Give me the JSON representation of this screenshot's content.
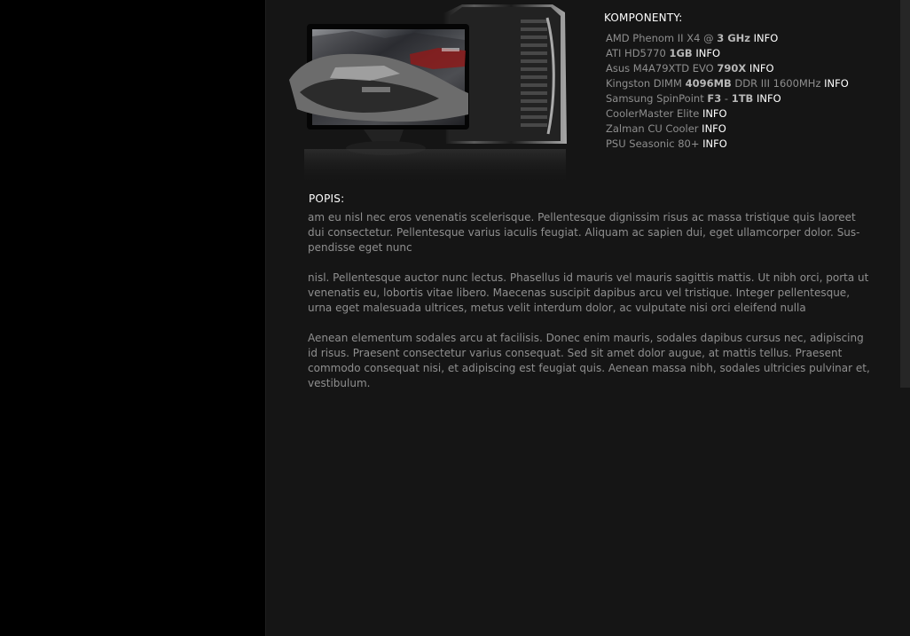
{
  "colors": {
    "page_background": "#000000",
    "content_background": "#151515",
    "heading_text": "#ffffff",
    "body_text": "#8f8f8f",
    "emphasis_text": "#b7b7b7",
    "link_text": "#ffffff"
  },
  "hero": {
    "icon_name": "computer-setup-image"
  },
  "components": {
    "heading": "KOMPONENTY:",
    "items": [
      {
        "segments": [
          {
            "text": "AMD Phenom II X4 @ ",
            "style": "normal"
          },
          {
            "text": "3 GHz",
            "style": "bold"
          },
          {
            "text": " ",
            "style": "normal"
          }
        ],
        "info_label": "INFO"
      },
      {
        "segments": [
          {
            "text": "ATI HD5770 ",
            "style": "normal"
          },
          {
            "text": "1GB",
            "style": "bold"
          },
          {
            "text": " ",
            "style": "normal"
          }
        ],
        "info_label": "INFO"
      },
      {
        "segments": [
          {
            "text": "Asus M4A79XTD EVO ",
            "style": "normal"
          },
          {
            "text": "790X",
            "style": "bold"
          },
          {
            "text": " ",
            "style": "normal"
          }
        ],
        "info_label": "INFO"
      },
      {
        "segments": [
          {
            "text": "Kingston DIMM ",
            "style": "normal"
          },
          {
            "text": "4096MB",
            "style": "bold"
          },
          {
            "text": " DDR III 1600MHz ",
            "style": "normal"
          }
        ],
        "info_label": "INFO"
      },
      {
        "segments": [
          {
            "text": "Samsung SpinPoint ",
            "style": "normal"
          },
          {
            "text": "F3",
            "style": "bold"
          },
          {
            "text": " - ",
            "style": "normal"
          },
          {
            "text": "1TB",
            "style": "bold"
          },
          {
            "text": " ",
            "style": "normal"
          }
        ],
        "info_label": "INFO"
      },
      {
        "segments": [
          {
            "text": "CoolerMaster Elite ",
            "style": "normal"
          }
        ],
        "info_label": "INFO"
      },
      {
        "segments": [
          {
            "text": "Zalman CU Cooler ",
            "style": "normal"
          }
        ],
        "info_label": "INFO"
      },
      {
        "segments": [
          {
            "text": "PSU Seasonic 80+ ",
            "style": "normal"
          }
        ],
        "info_label": "INFO"
      }
    ]
  },
  "description": {
    "heading": "POPIS:",
    "paragraphs": [
      "am eu nisl nec eros venenatis scelerisque. Pellentesque dignissim risus ac massa tristique quis laoreet dui consectetur. Pellentesque varius iaculis feugiat. Aliquam ac sapien dui, eget ullamcorper dolor. Sus-pendisse eget nunc",
      "nisl. Pellentesque auctor nunc lectus. Phasellus id mauris vel mauris sagittis mattis. Ut nibh orci, porta ut venenatis eu, lobortis vitae libero. Maecenas suscipit dapibus arcu vel tristique. Integer pellentesque, urna eget malesuada ultrices, metus velit interdum dolor, ac vulputate nisi orci eleifend nulla",
      "Aenean elementum sodales arcu at facilisis. Donec enim mauris, sodales dapibus cursus nec, adipiscing id risus. Praesent consectetur varius consequat. Sed sit amet dolor augue, at mattis tellus. Praesent commodo consequat nisi, et adipiscing est feugiat quis. Aenean massa nibh, sodales ultricies pulvinar et, vestibulum."
    ]
  }
}
